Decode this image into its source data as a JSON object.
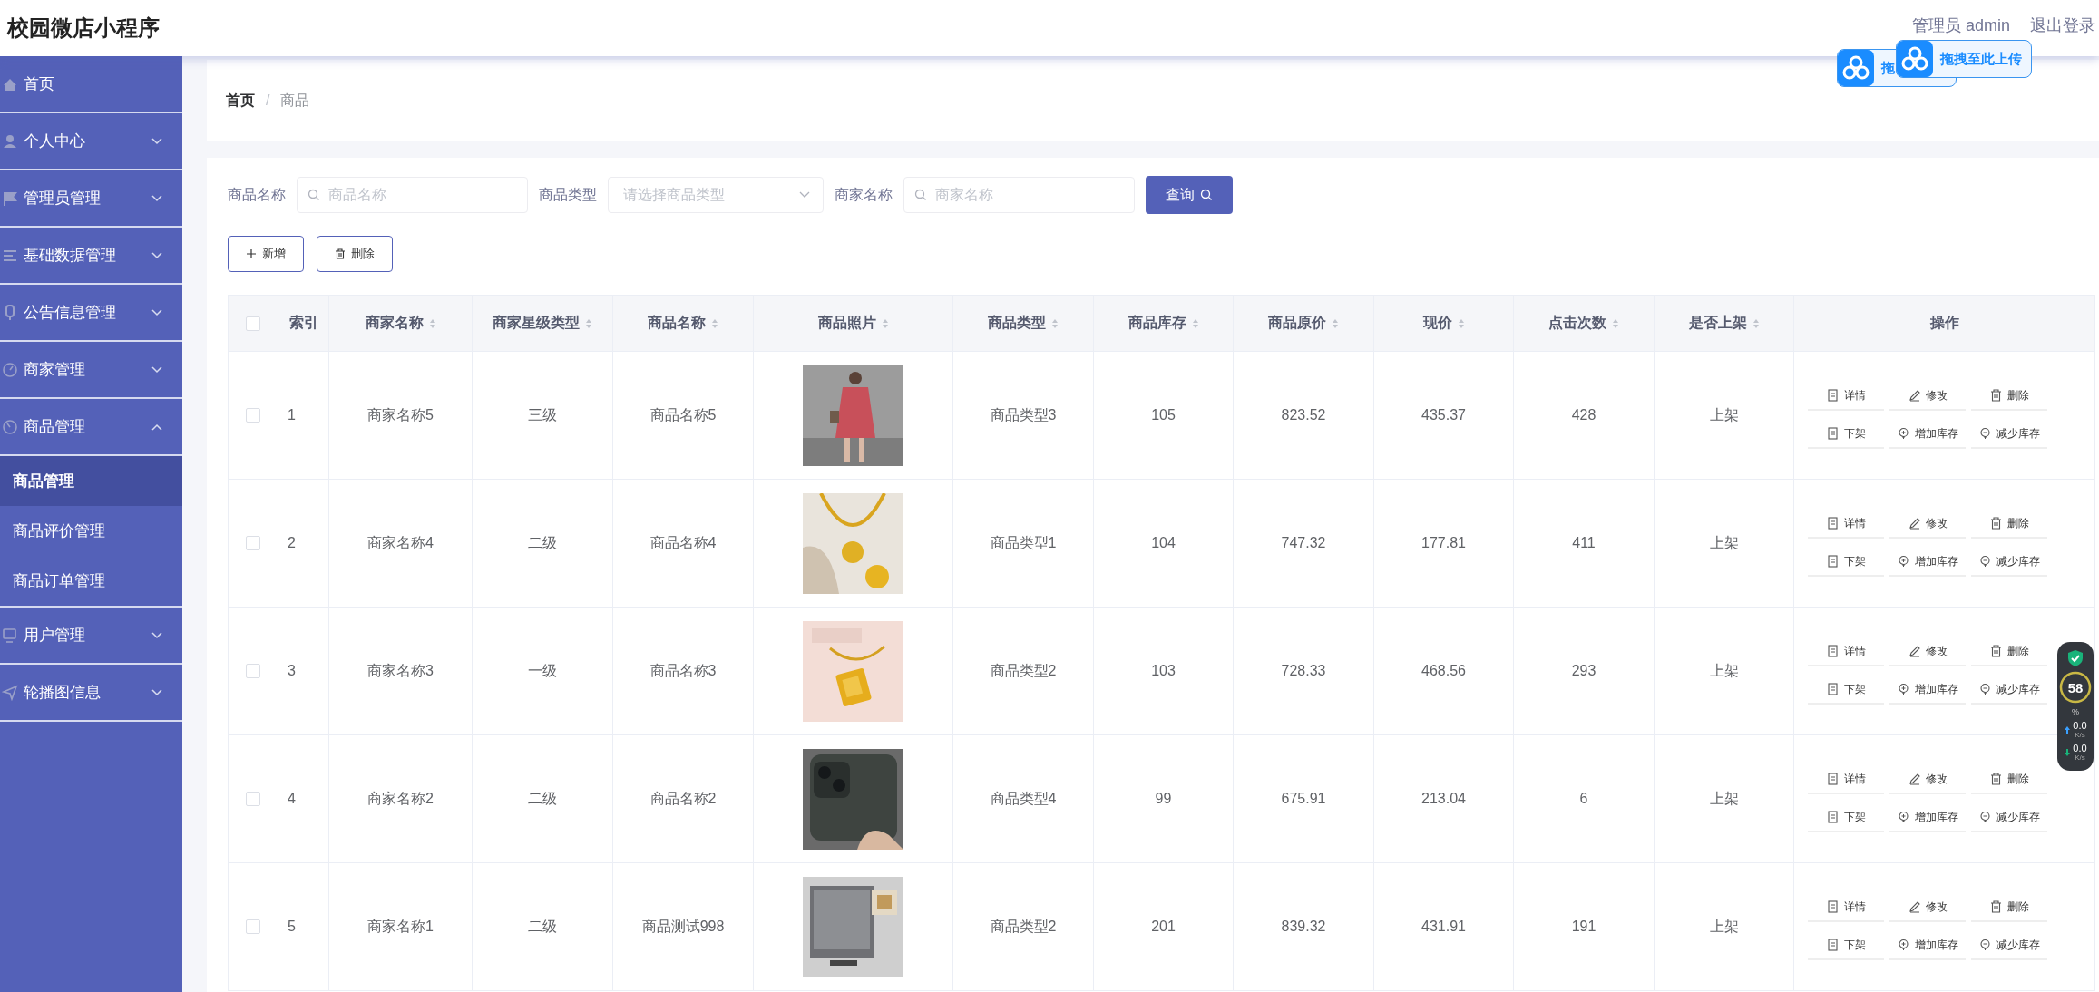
{
  "header": {
    "title": "校园微店小程序",
    "user": "管理员 admin",
    "logout": "退出登录"
  },
  "upload_popups": [
    {
      "label": "拖"
    },
    {
      "label": "拖拽至此上传"
    }
  ],
  "sidebar": {
    "items": [
      {
        "label": "首页",
        "kind": "link"
      },
      {
        "label": "个人中心",
        "kind": "menu",
        "expanded": false
      },
      {
        "label": "管理员管理",
        "kind": "menu",
        "expanded": false
      },
      {
        "label": "基础数据管理",
        "kind": "menu",
        "expanded": false
      },
      {
        "label": "公告信息管理",
        "kind": "menu",
        "expanded": false
      },
      {
        "label": "商家管理",
        "kind": "menu",
        "expanded": false
      },
      {
        "label": "商品管理",
        "kind": "menu",
        "expanded": true,
        "children": [
          {
            "label": "商品管理",
            "selected": true
          },
          {
            "label": "商品评价管理",
            "selected": false
          },
          {
            "label": "商品订单管理",
            "selected": false
          }
        ]
      },
      {
        "label": "用户管理",
        "kind": "menu",
        "expanded": false
      },
      {
        "label": "轮播图信息",
        "kind": "menu",
        "expanded": false
      }
    ]
  },
  "breadcrumb": [
    "首页",
    "/",
    "商品"
  ],
  "filters": [
    {
      "label": "商品名称",
      "kind": "input",
      "placeholder": "商品名称"
    },
    {
      "label": "商品类型",
      "kind": "select",
      "placeholder": "请选择商品类型"
    },
    {
      "label": "商家名称",
      "kind": "input",
      "placeholder": "商家名称"
    }
  ],
  "search_button": "查询",
  "toolbar": [
    "新增",
    "删除"
  ],
  "table": {
    "select_all_checked": false,
    "columns": [
      {
        "label": "索引",
        "sortable": false
      },
      {
        "label": "商家名称",
        "sortable": true
      },
      {
        "label": "商家星级类型",
        "sortable": true
      },
      {
        "label": "商品名称",
        "sortable": true
      },
      {
        "label": "商品照片",
        "sortable": true
      },
      {
        "label": "商品类型",
        "sortable": true
      },
      {
        "label": "商品库存",
        "sortable": true
      },
      {
        "label": "商品原价",
        "sortable": true
      },
      {
        "label": "现价",
        "sortable": true
      },
      {
        "label": "点击次数",
        "sortable": true
      },
      {
        "label": "是否上架",
        "sortable": true
      },
      {
        "label": "操作",
        "sortable": false
      }
    ],
    "rows": [
      {
        "selected": false,
        "cells": [
          "1",
          "商家名称5",
          "三级",
          "商品名称5",
          {
            "kind": "picture"
          },
          "商品类型3",
          "105",
          "823.52",
          "435.37",
          "428",
          "上架"
        ],
        "actions": [
          "详情",
          "修改",
          "删除",
          "下架",
          "增加库存",
          "减少库存"
        ]
      },
      {
        "selected": false,
        "cells": [
          "2",
          "商家名称4",
          "二级",
          "商品名称4",
          {
            "kind": "picture"
          },
          "商品类型1",
          "104",
          "747.32",
          "177.81",
          "411",
          "上架"
        ],
        "actions": [
          "详情",
          "修改",
          "删除",
          "下架",
          "增加库存",
          "减少库存"
        ]
      },
      {
        "selected": false,
        "cells": [
          "3",
          "商家名称3",
          "一级",
          "商品名称3",
          {
            "kind": "picture"
          },
          "商品类型2",
          "103",
          "728.33",
          "468.56",
          "293",
          "上架"
        ],
        "actions": [
          "详情",
          "修改",
          "删除",
          "下架",
          "增加库存",
          "减少库存"
        ]
      },
      {
        "selected": false,
        "cells": [
          "4",
          "商家名称2",
          "二级",
          "商品名称2",
          {
            "kind": "picture"
          },
          "商品类型4",
          "99",
          "675.91",
          "213.04",
          "6",
          "上架"
        ],
        "actions": [
          "详情",
          "修改",
          "删除",
          "下架",
          "增加库存",
          "减少库存"
        ]
      },
      {
        "selected": false,
        "cells": [
          "5",
          "商家名称1",
          "二级",
          "商品测试998",
          {
            "kind": "picture"
          },
          "商品类型2",
          "201",
          "839.32",
          "431.91",
          "191",
          "上架"
        ],
        "actions": [
          "详情",
          "修改",
          "删除",
          "下架",
          "增加库存",
          "减少库存"
        ]
      }
    ]
  },
  "speed_widget": {
    "percent": "58",
    "unit": "%",
    "upload": "0.0",
    "upload_unit": "K/s",
    "download": "0.0",
    "download_unit": "K/s"
  }
}
